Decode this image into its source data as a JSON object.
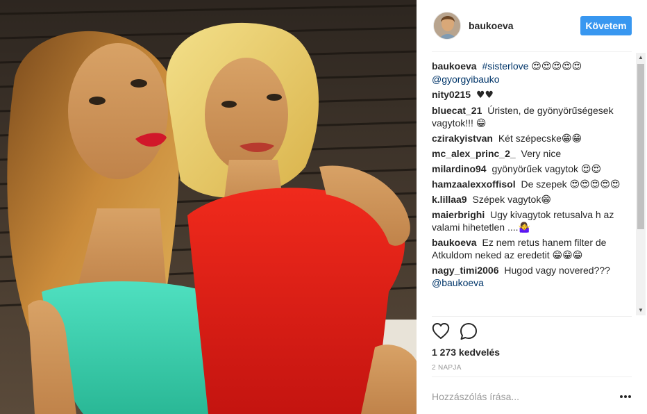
{
  "header": {
    "username": "baukoeva",
    "follow_label": "Követem"
  },
  "comments": [
    {
      "user": "baukoeva",
      "text": "",
      "hashtag": "#sisterlove",
      "emoji": "😍😍😍😍😍",
      "mention": "@gyorgyibauko"
    },
    {
      "user": "nity0215",
      "text": "♥♥"
    },
    {
      "user": "bluecat_21",
      "text": "Úristen, de gyönyörűségesek vagytok!!! 😁"
    },
    {
      "user": "czirakyistvan",
      "text": "Két szépecske😁😁"
    },
    {
      "user": "mc_alex_princ_2_",
      "text": "Very nice"
    },
    {
      "user": "milardino94",
      "text": "gyönyörűek vagytok 😍😍"
    },
    {
      "user": "hamzaalexxoffisol",
      "text": "De szepek 😍😍😍😍😍"
    },
    {
      "user": "k.lillaa9",
      "text": "Szépek vagytok😁"
    },
    {
      "user": "maierbrighi",
      "text": "Ugy kivagytok retusalva h az valami hihetetlen ....🤷‍♀️"
    },
    {
      "user": "baukoeva",
      "text": "Ez nem retus hanem filter de Atkuldom neked az eredetit 😁😁😁"
    },
    {
      "user": "nagy_timi2006",
      "text": "Hugod vagy novered???",
      "mention": "@baukoeva"
    }
  ],
  "actions": {
    "likes": "1 273 kedvelés",
    "date": "2 NAPJA"
  },
  "add_comment": {
    "placeholder": "Hozzászólás írása..."
  },
  "icons": {
    "like": "heart-icon",
    "comment": "speech-bubble-icon",
    "more": "more-dots-icon"
  },
  "colors": {
    "accent": "#3897f0",
    "link": "#003569",
    "text": "#262626",
    "muted": "#999999"
  }
}
